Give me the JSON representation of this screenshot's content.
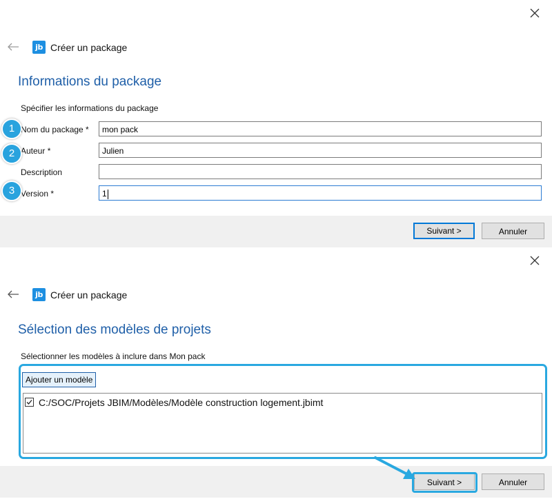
{
  "panel1": {
    "window_title": "Créer un package",
    "logo_text": "jb",
    "page_title": "Informations du package",
    "subtitle": "Spécifier les informations du package",
    "fields": [
      {
        "label": "Nom du package *",
        "value": "mon pack",
        "badge": "1"
      },
      {
        "label": "Auteur *",
        "value": "Julien",
        "badge": "2"
      },
      {
        "label": "Description",
        "value": ""
      },
      {
        "label": "Version *",
        "value": "1",
        "badge": "3"
      }
    ],
    "next_label": "Suivant >",
    "cancel_label": "Annuler"
  },
  "panel2": {
    "window_title": "Créer un package",
    "logo_text": "jb",
    "page_title": "Sélection des modèles de projets",
    "subtitle": "Sélectionner les modèles à inclure dans Mon pack",
    "add_button_label": "Ajouter un modèle",
    "items": [
      {
        "checked": true,
        "path": "C:/SOC/Projets JBIM/Modèles/Modèle construction logement.jbimt"
      }
    ],
    "next_label": "Suivant >",
    "cancel_label": "Annuler"
  },
  "colors": {
    "accent": "#1f5fa8",
    "highlight": "#29a8e0",
    "logo": "#1d8fe1",
    "footer": "#f0f0f0"
  },
  "icons": [
    "close-icon",
    "back-arrow-icon",
    "jb-logo-icon",
    "checkbox-checked-icon"
  ]
}
